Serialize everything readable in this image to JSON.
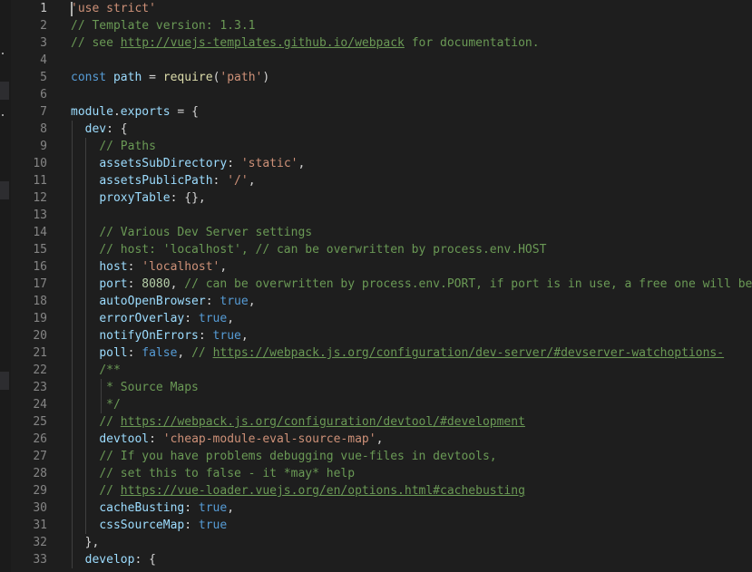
{
  "editor": {
    "active_line": 1,
    "lines": [
      {
        "n": "1",
        "tokens": [
          {
            "t": "string",
            "v": "'use strict'"
          }
        ]
      },
      {
        "n": "2",
        "tokens": [
          {
            "t": "comment",
            "v": "// Template version: 1.3.1"
          }
        ]
      },
      {
        "n": "3",
        "tokens": [
          {
            "t": "comment",
            "v": "// see "
          },
          {
            "t": "link",
            "v": "http://vuejs-templates.github.io/webpack"
          },
          {
            "t": "comment",
            "v": " for documentation."
          }
        ]
      },
      {
        "n": "4",
        "tokens": []
      },
      {
        "n": "5",
        "tokens": [
          {
            "t": "keyword",
            "v": "const"
          },
          {
            "t": "plain",
            "v": " "
          },
          {
            "t": "prop",
            "v": "path"
          },
          {
            "t": "plain",
            "v": " = "
          },
          {
            "t": "func",
            "v": "require"
          },
          {
            "t": "plain",
            "v": "("
          },
          {
            "t": "string",
            "v": "'path'"
          },
          {
            "t": "plain",
            "v": ")"
          }
        ]
      },
      {
        "n": "6",
        "tokens": []
      },
      {
        "n": "7",
        "tokens": [
          {
            "t": "prop",
            "v": "module"
          },
          {
            "t": "plain",
            "v": "."
          },
          {
            "t": "prop",
            "v": "exports"
          },
          {
            "t": "plain",
            "v": " = {"
          }
        ]
      },
      {
        "n": "8",
        "tokens": [
          {
            "t": "plain",
            "v": "  "
          },
          {
            "t": "prop",
            "v": "dev"
          },
          {
            "t": "plain",
            "v": ": {"
          }
        ]
      },
      {
        "n": "9",
        "tokens": [
          {
            "t": "plain",
            "v": "    "
          },
          {
            "t": "comment",
            "v": "// Paths"
          }
        ]
      },
      {
        "n": "10",
        "tokens": [
          {
            "t": "plain",
            "v": "    "
          },
          {
            "t": "prop",
            "v": "assetsSubDirectory"
          },
          {
            "t": "plain",
            "v": ": "
          },
          {
            "t": "string",
            "v": "'static'"
          },
          {
            "t": "plain",
            "v": ","
          }
        ]
      },
      {
        "n": "11",
        "tokens": [
          {
            "t": "plain",
            "v": "    "
          },
          {
            "t": "prop",
            "v": "assetsPublicPath"
          },
          {
            "t": "plain",
            "v": ": "
          },
          {
            "t": "string",
            "v": "'/'"
          },
          {
            "t": "plain",
            "v": ","
          }
        ]
      },
      {
        "n": "12",
        "tokens": [
          {
            "t": "plain",
            "v": "    "
          },
          {
            "t": "prop",
            "v": "proxyTable"
          },
          {
            "t": "plain",
            "v": ": {},"
          }
        ]
      },
      {
        "n": "13",
        "tokens": []
      },
      {
        "n": "14",
        "tokens": [
          {
            "t": "plain",
            "v": "    "
          },
          {
            "t": "comment",
            "v": "// Various Dev Server settings"
          }
        ]
      },
      {
        "n": "15",
        "tokens": [
          {
            "t": "plain",
            "v": "    "
          },
          {
            "t": "comment",
            "v": "// host: 'localhost', // can be overwritten by process.env.HOST"
          }
        ]
      },
      {
        "n": "16",
        "tokens": [
          {
            "t": "plain",
            "v": "    "
          },
          {
            "t": "prop",
            "v": "host"
          },
          {
            "t": "plain",
            "v": ": "
          },
          {
            "t": "string",
            "v": "'localhost'"
          },
          {
            "t": "plain",
            "v": ","
          }
        ]
      },
      {
        "n": "17",
        "tokens": [
          {
            "t": "plain",
            "v": "    "
          },
          {
            "t": "prop",
            "v": "port"
          },
          {
            "t": "plain",
            "v": ": "
          },
          {
            "t": "number",
            "v": "8080"
          },
          {
            "t": "plain",
            "v": ", "
          },
          {
            "t": "comment",
            "v": "// can be overwritten by process.env.PORT, if port is in use, a free one will be d"
          }
        ]
      },
      {
        "n": "18",
        "tokens": [
          {
            "t": "plain",
            "v": "    "
          },
          {
            "t": "prop",
            "v": "autoOpenBrowser"
          },
          {
            "t": "plain",
            "v": ": "
          },
          {
            "t": "keyword",
            "v": "true"
          },
          {
            "t": "plain",
            "v": ","
          }
        ]
      },
      {
        "n": "19",
        "tokens": [
          {
            "t": "plain",
            "v": "    "
          },
          {
            "t": "prop",
            "v": "errorOverlay"
          },
          {
            "t": "plain",
            "v": ": "
          },
          {
            "t": "keyword",
            "v": "true"
          },
          {
            "t": "plain",
            "v": ","
          }
        ]
      },
      {
        "n": "20",
        "tokens": [
          {
            "t": "plain",
            "v": "    "
          },
          {
            "t": "prop",
            "v": "notifyOnErrors"
          },
          {
            "t": "plain",
            "v": ": "
          },
          {
            "t": "keyword",
            "v": "true"
          },
          {
            "t": "plain",
            "v": ","
          }
        ]
      },
      {
        "n": "21",
        "tokens": [
          {
            "t": "plain",
            "v": "    "
          },
          {
            "t": "prop",
            "v": "poll"
          },
          {
            "t": "plain",
            "v": ": "
          },
          {
            "t": "keyword",
            "v": "false"
          },
          {
            "t": "plain",
            "v": ", "
          },
          {
            "t": "comment",
            "v": "// "
          },
          {
            "t": "link",
            "v": "https://webpack.js.org/configuration/dev-server/#devserver-watchoptions-"
          }
        ]
      },
      {
        "n": "22",
        "tokens": [
          {
            "t": "plain",
            "v": "    "
          },
          {
            "t": "comment",
            "v": "/**"
          }
        ]
      },
      {
        "n": "23",
        "tokens": [
          {
            "t": "plain",
            "v": "    "
          },
          {
            "t": "comment",
            "v": " * Source Maps"
          }
        ]
      },
      {
        "n": "24",
        "tokens": [
          {
            "t": "plain",
            "v": "    "
          },
          {
            "t": "comment",
            "v": " */"
          }
        ]
      },
      {
        "n": "25",
        "tokens": [
          {
            "t": "plain",
            "v": "    "
          },
          {
            "t": "comment",
            "v": "// "
          },
          {
            "t": "link",
            "v": "https://webpack.js.org/configuration/devtool/#development"
          }
        ]
      },
      {
        "n": "26",
        "tokens": [
          {
            "t": "plain",
            "v": "    "
          },
          {
            "t": "prop",
            "v": "devtool"
          },
          {
            "t": "plain",
            "v": ": "
          },
          {
            "t": "string",
            "v": "'cheap-module-eval-source-map'"
          },
          {
            "t": "plain",
            "v": ","
          }
        ]
      },
      {
        "n": "27",
        "tokens": [
          {
            "t": "plain",
            "v": "    "
          },
          {
            "t": "comment",
            "v": "// If you have problems debugging vue-files in devtools,"
          }
        ]
      },
      {
        "n": "28",
        "tokens": [
          {
            "t": "plain",
            "v": "    "
          },
          {
            "t": "comment",
            "v": "// set this to false - it *may* help"
          }
        ]
      },
      {
        "n": "29",
        "tokens": [
          {
            "t": "plain",
            "v": "    "
          },
          {
            "t": "comment",
            "v": "// "
          },
          {
            "t": "link",
            "v": "https://vue-loader.vuejs.org/en/options.html#cachebusting"
          }
        ]
      },
      {
        "n": "30",
        "tokens": [
          {
            "t": "plain",
            "v": "    "
          },
          {
            "t": "prop",
            "v": "cacheBusting"
          },
          {
            "t": "plain",
            "v": ": "
          },
          {
            "t": "keyword",
            "v": "true"
          },
          {
            "t": "plain",
            "v": ","
          }
        ]
      },
      {
        "n": "31",
        "tokens": [
          {
            "t": "plain",
            "v": "    "
          },
          {
            "t": "prop",
            "v": "cssSourceMap"
          },
          {
            "t": "plain",
            "v": ": "
          },
          {
            "t": "keyword",
            "v": "true"
          }
        ]
      },
      {
        "n": "32",
        "tokens": [
          {
            "t": "plain",
            "v": "  },"
          }
        ]
      },
      {
        "n": "33",
        "tokens": [
          {
            "t": "plain",
            "v": "  "
          },
          {
            "t": "prop",
            "v": "develop"
          },
          {
            "t": "plain",
            "v": ": {"
          }
        ]
      }
    ]
  },
  "colors": {
    "background": "#1e1e1e",
    "comment": "#6a9955",
    "string": "#ce9178",
    "keyword": "#569cd6",
    "property": "#9cdcfe",
    "function": "#dcdcaa",
    "number": "#b5cea8"
  }
}
